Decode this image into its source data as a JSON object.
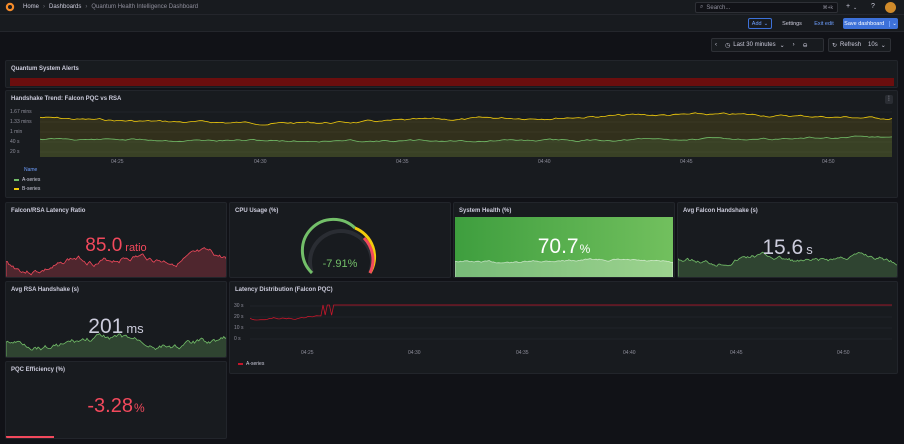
{
  "topbar": {
    "crumbs": [
      "Home",
      "Dashboards",
      "Quantum Health Intelligence Dashboard"
    ],
    "search_placeholder": "Search...",
    "search_kbd": "⌘+k"
  },
  "toolbar": {
    "add_label": "Add",
    "settings_label": "Settings",
    "exit_label": "Exit edit",
    "save_label": "Save dashboard"
  },
  "timepicker": {
    "range": "Last 30 minutes",
    "refresh_label": "Refresh",
    "interval": "10s"
  },
  "panels": {
    "alerts": {
      "title": "Quantum System Alerts"
    },
    "handshake": {
      "title": "Handshake Trend: Falcon PQC vs RSA",
      "y_ticks": [
        "1.67 mins",
        "1.33 mins",
        "1 min",
        "40 s",
        "20 s"
      ],
      "x_ticks": [
        "04:25",
        "04:30",
        "04:35",
        "04:40",
        "04:45",
        "04:50"
      ],
      "legend_header": "Name",
      "legend": [
        "A-series",
        "B-series"
      ]
    },
    "ratio": {
      "title": "Falcon/RSA Latency Ratio",
      "value": "85.0",
      "unit": "ratio"
    },
    "cpu": {
      "title": "CPU Usage (%)",
      "value": "-7.91%"
    },
    "health": {
      "title": "System Health (%)",
      "value": "70.7",
      "unit": "%"
    },
    "avg_falcon": {
      "title": "Avg Falcon Handshake (s)",
      "value": "15.6",
      "unit": "s"
    },
    "avg_rsa": {
      "title": "Avg RSA Handshake (s)",
      "value": "201",
      "unit": "ms"
    },
    "latency": {
      "title": "Latency Distribution (Falcon PQC)",
      "y_ticks": [
        "30 s",
        "20 s",
        "10 s",
        "0 s"
      ],
      "x_ticks": [
        "04:25",
        "04:30",
        "04:35",
        "04:40",
        "04:45",
        "04:50"
      ],
      "legend": [
        "A-series"
      ]
    },
    "efficiency": {
      "title": "PQC Efficiency (%)",
      "value": "-3.28",
      "unit": "%"
    }
  },
  "colors": {
    "green": "#73bf69",
    "yellow": "#f2cc0c",
    "red": "#f2495c",
    "blue": "#3d71d9",
    "alert_red": "#6b0e0e"
  }
}
